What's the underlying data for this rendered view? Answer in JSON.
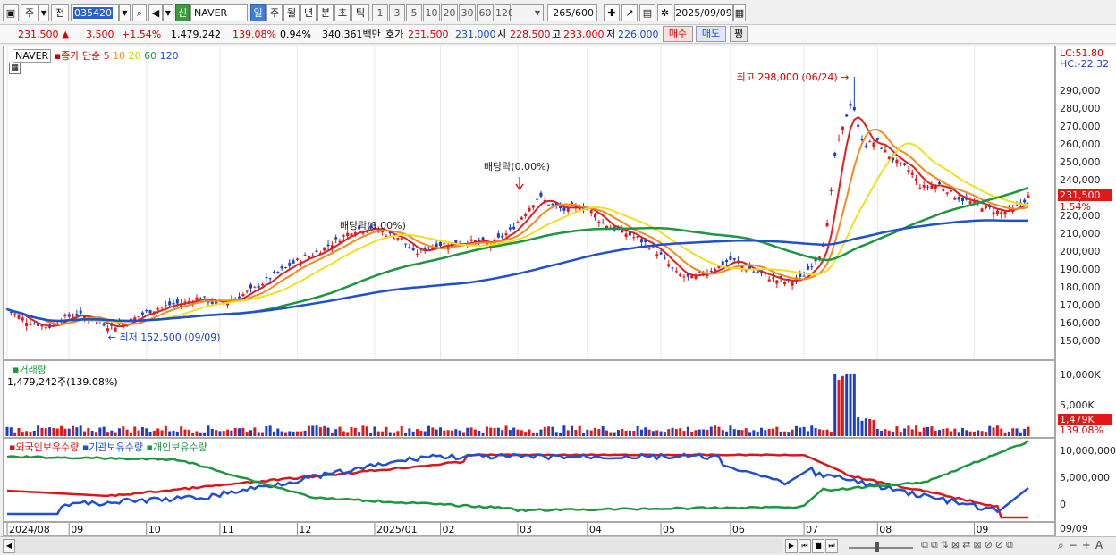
{
  "toolbar": {
    "type_label": "주",
    "prev_label": "전",
    "stock_code": "035420",
    "sin_label": "신",
    "stock_name": "NAVER",
    "periods": [
      "일",
      "주",
      "월",
      "년",
      "분",
      "초",
      "틱"
    ],
    "intervals": [
      "1",
      "3",
      "5",
      "10",
      "20",
      "30",
      "60",
      "120"
    ],
    "count": "265",
    "count_total": "/600",
    "date": "2025/09/09"
  },
  "info": {
    "price": "231,500 ▲",
    "change": "3,500",
    "change_pct": "+1.54%",
    "volume": "1,479,242",
    "volume_pct": "139.08%",
    "turnover_pct": "0.94%",
    "amount": "340,361백만",
    "quote_label": "호가",
    "ask": "231,500",
    "bid": "231,000",
    "open_label": "시",
    "open": "228,500",
    "high_label": "고",
    "high": "233,000",
    "low_label": "저",
    "low": "226,000",
    "buy_label": "매수",
    "sell_label": "매도",
    "eval_label": "평"
  },
  "price_panel": {
    "legend_name": "NAVER",
    "legend_series": "종가 단순",
    "ma_labels": [
      "5",
      "10",
      "20",
      "60",
      "120"
    ],
    "ma_colors": [
      "#e02020",
      "#f08c1e",
      "#f0e020",
      "#1e9640",
      "#2050d0"
    ],
    "lc": "LC:51.80",
    "hc": "HC:-22.32",
    "high_annotation": "최고 298,000 (06/24)",
    "low_annotation": "최저 152,500 (09/09)",
    "dividend1": "배당락(0.00%)",
    "dividend2": "배당락(0.00%)",
    "current_price_tag": "231,500",
    "current_pct_tag": "1.54%",
    "y_ticks": [
      "290,000",
      "280,000",
      "270,000",
      "260,000",
      "250,000",
      "240,000",
      "230,000",
      "220,000",
      "210,000",
      "200,000",
      "190,000",
      "180,000",
      "170,000",
      "160,000",
      "150,000"
    ]
  },
  "volume_panel": {
    "title": "거래량",
    "value": "1,479,242주(139.08%)",
    "y_ticks": [
      "10,000K",
      "5,000K"
    ],
    "current_tag": "1,479K",
    "current_pct": "139.08%"
  },
  "holding_panel": {
    "legend": [
      "외국인보유수량",
      "기관보유수량",
      "개인보유수량"
    ],
    "legend_colors": [
      "#d81818",
      "#2050d0",
      "#1e9640"
    ],
    "y_ticks": [
      "10,000,000",
      "5,000,000",
      "0"
    ]
  },
  "x_axis": {
    "labels": [
      "2024/08",
      "09",
      "10",
      "11",
      "12",
      "2025/01",
      "02",
      "03",
      "04",
      "05",
      "06",
      "07",
      "08",
      "09"
    ],
    "right_label": "09/09"
  }
}
